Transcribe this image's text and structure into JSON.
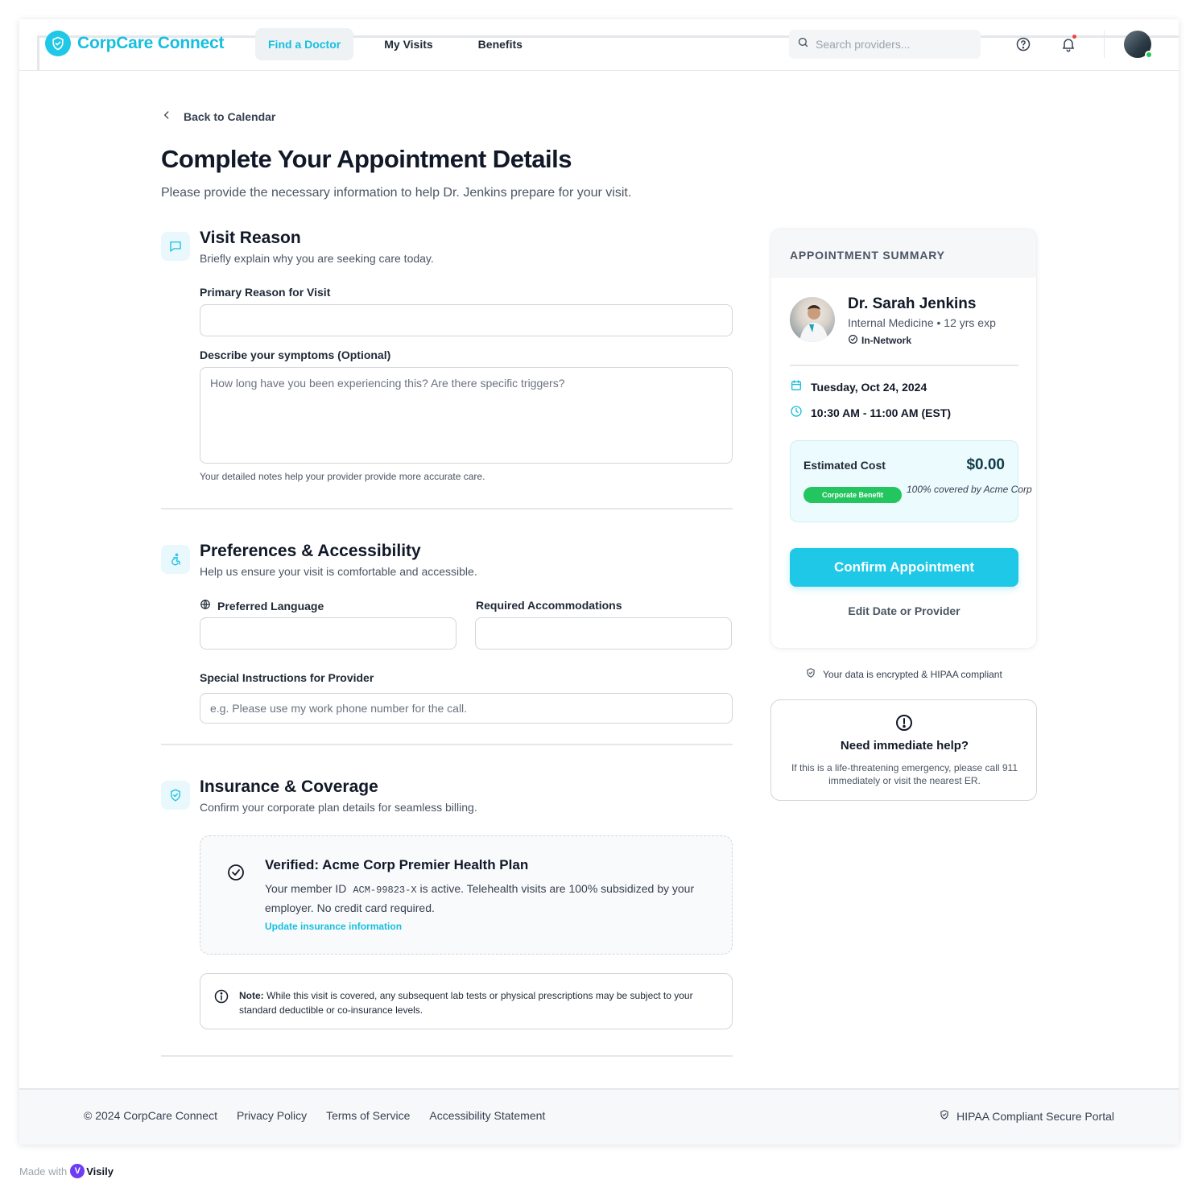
{
  "app": {
    "name": "CorpCare Connect",
    "brand_color": "#1ec8e6"
  },
  "nav": {
    "items": [
      {
        "label": "Find a Doctor",
        "active": true
      },
      {
        "label": "My Visits",
        "active": false
      },
      {
        "label": "Benefits",
        "active": false
      }
    ]
  },
  "search": {
    "placeholder": "Search providers..."
  },
  "header_icons": [
    "help-icon",
    "bell-icon",
    "avatar"
  ],
  "page": {
    "back_label": "Back to Calendar",
    "title": "Complete Your Appointment Details",
    "subtitle": "Please provide the necessary information to help Dr. Jenkins prepare for your visit."
  },
  "visit_reason": {
    "title": "Visit Reason",
    "subtitle": "Briefly explain why you are seeking care today.",
    "primary_label": "Primary Reason for Visit",
    "primary_value": "",
    "symptoms_label": "Describe your symptoms (Optional)",
    "symptoms_placeholder": "How long have you been experiencing this? Are there specific triggers?",
    "hint": "Your detailed notes help your provider provide more accurate care."
  },
  "preferences": {
    "title": "Preferences & Accessibility",
    "subtitle": "Help us ensure your visit is comfortable and accessible.",
    "language_label": "Preferred Language",
    "language_value": "",
    "accommodations_label": "Required Accommodations",
    "accommodations_value": "",
    "instructions_label": "Special Instructions for Provider",
    "instructions_placeholder": "e.g. Please use my work phone number for the call."
  },
  "insurance": {
    "title": "Insurance & Coverage",
    "subtitle": "Confirm your corporate plan details for seamless billing.",
    "verified_title": "Verified: Acme Corp Premier Health Plan",
    "member_prefix": "Your member ID",
    "member_id": "ACM-99823-X",
    "member_suffix": "is active. Telehealth visits are 100% subsidized by your employer. No credit card required.",
    "update_link": "Update insurance information",
    "note_label": "Note:",
    "note_text": "While this visit is covered, any subsequent lab tests or physical prescriptions may be subject to your standard deductible or co-insurance levels."
  },
  "summary": {
    "heading": "APPOINTMENT SUMMARY",
    "doctor_name": "Dr. Sarah Jenkins",
    "doctor_spec": "Internal Medicine • 12 yrs exp",
    "network": "In-Network",
    "date": "Tuesday, Oct 24, 2024",
    "time": "10:30 AM - 11:00 AM (EST)",
    "cost_label": "Estimated Cost",
    "cost_value": "$0.00",
    "badge": "Corporate Benefit",
    "coverage_note": "100% covered by Acme Corp",
    "confirm_label": "Confirm Appointment",
    "edit_label": "Edit Date or Provider"
  },
  "secure_note": "Your data is encrypted & HIPAA compliant",
  "help": {
    "title": "Need immediate help?",
    "text": "If this is a life-threatening emergency, please call 911 immediately or visit the nearest ER."
  },
  "footer": {
    "copyright": "© 2024 CorpCare Connect",
    "links": [
      "Privacy Policy",
      "Terms of Service",
      "Accessibility Statement"
    ],
    "right": "HIPAA Compliant Secure Portal"
  },
  "made_with": {
    "prefix": "Made with",
    "brand": "Visily"
  }
}
